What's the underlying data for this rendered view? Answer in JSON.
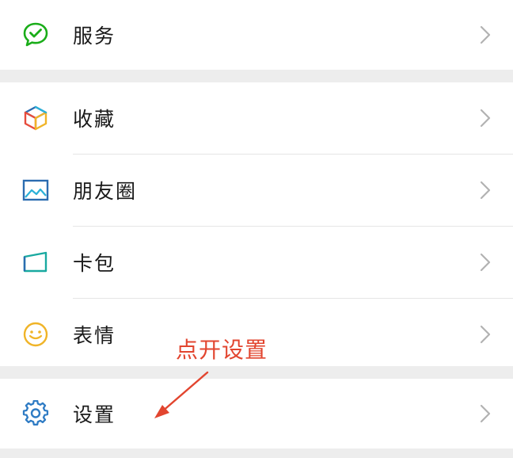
{
  "groups": [
    {
      "items": [
        {
          "label": "服务",
          "icon": "service-chat-icon"
        }
      ]
    },
    {
      "items": [
        {
          "label": "收藏",
          "icon": "favorites-cube-icon"
        },
        {
          "label": "朋友圈",
          "icon": "moments-picture-icon"
        },
        {
          "label": "卡包",
          "icon": "card-wallet-icon"
        },
        {
          "label": "表情",
          "icon": "sticker-smile-icon"
        }
      ]
    },
    {
      "items": [
        {
          "label": "设置",
          "icon": "settings-gear-icon"
        }
      ]
    }
  ],
  "annotation": {
    "text": "点开设置",
    "color": "#e2452f"
  },
  "colors": {
    "page_background": "#ededed",
    "row_background": "#ffffff",
    "label": "#1a1a1a",
    "chevron": "#b2b2b2",
    "service_icon": "#1aad19",
    "moments_icon": "#2b6cb0",
    "card_icon": "#19a9a0",
    "sticker_icon": "#f0b428",
    "settings_icon": "#2e7bc4"
  }
}
